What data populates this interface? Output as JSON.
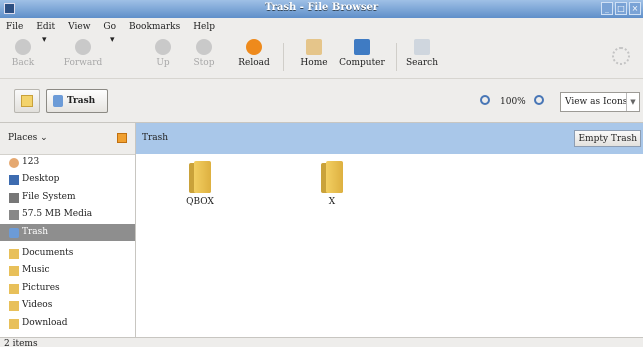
{
  "window": {
    "title": "Trash - File Browser"
  },
  "menu": [
    "File",
    "Edit",
    "View",
    "Go",
    "Bookmarks",
    "Help"
  ],
  "toolbar": {
    "back": "Back",
    "forward": "Forward",
    "up": "Up",
    "stop": "Stop",
    "reload": "Reload",
    "home": "Home",
    "computer": "Computer",
    "search": "Search"
  },
  "location": {
    "crumb": "Trash",
    "zoom": "100%",
    "view_mode": "View as Icons"
  },
  "side_pane": {
    "title": "Places",
    "items": [
      "123",
      "Desktop",
      "File System",
      "57.5 MB Media",
      "Trash",
      "Documents",
      "Music",
      "Pictures",
      "Videos",
      "Download"
    ]
  },
  "main": {
    "path": "Trash",
    "empty_button": "Empty Trash",
    "files": [
      "QBOX",
      "X"
    ]
  },
  "status": "2 items",
  "colors": {
    "title_bar": "#5f8fc9",
    "path_bar": "#a9c7e9",
    "selected": "#8e8e8e",
    "folder": "#f3cf62"
  }
}
